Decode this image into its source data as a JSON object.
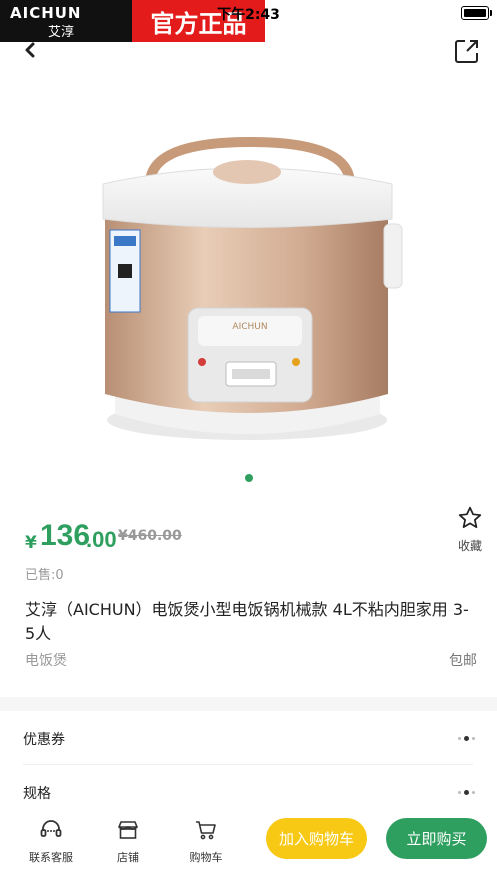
{
  "status_bar": {
    "time": "下午2:43"
  },
  "brand_banner": {
    "logo_en": "AICHUN",
    "logo_cn": "艾淳",
    "tagline": "官方正品"
  },
  "product": {
    "currency": "¥",
    "price_int": "136",
    "price_dec": ".00",
    "original_price": "¥460.00",
    "sold": "已售:0",
    "title": "艾淳（AICHUN）电饭煲小型电饭锅机械款 4L不粘内胆家用 3-5人",
    "category": "电饭煲",
    "shipping": "包邮",
    "image_count": 1,
    "image_active_index": 0
  },
  "favorite": {
    "label": "收藏",
    "icon": "star-icon"
  },
  "rows": [
    {
      "label": "优惠券"
    },
    {
      "label": "规格"
    }
  ],
  "bottom_bar": {
    "customer_service": "联系客服",
    "store": "店铺",
    "cart": "购物车",
    "add_to_cart": "加入购物车",
    "buy_now": "立即购买"
  },
  "colors": {
    "accent": "#2e9f5f",
    "cart_button": "#f7c814",
    "banner_red": "#e41b1b",
    "banner_black": "#111111"
  }
}
